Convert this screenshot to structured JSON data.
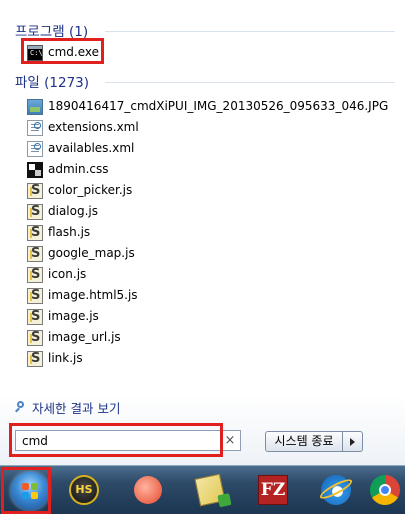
{
  "programs": {
    "header": "프로그램 (1)",
    "items": [
      {
        "label": "cmd.exe",
        "icon": "cmd-icon"
      }
    ]
  },
  "files": {
    "header": "파일 (1273)",
    "items": [
      {
        "label": "1890416417_cmdXiPUI_IMG_20130526_095633_046.JPG",
        "icon": "image-file-icon"
      },
      {
        "label": "extensions.xml",
        "icon": "xml-file-icon"
      },
      {
        "label": "availables.xml",
        "icon": "xml-file-icon"
      },
      {
        "label": "admin.css",
        "icon": "css-file-icon"
      },
      {
        "label": "color_picker.js",
        "icon": "js-file-icon"
      },
      {
        "label": "dialog.js",
        "icon": "js-file-icon"
      },
      {
        "label": "flash.js",
        "icon": "js-file-icon"
      },
      {
        "label": "google_map.js",
        "icon": "js-file-icon"
      },
      {
        "label": "icon.js",
        "icon": "js-file-icon"
      },
      {
        "label": "image.html5.js",
        "icon": "js-file-icon"
      },
      {
        "label": "image.js",
        "icon": "js-file-icon"
      },
      {
        "label": "image_url.js",
        "icon": "js-file-icon"
      },
      {
        "label": "link.js",
        "icon": "js-file-icon"
      }
    ]
  },
  "more_results": "자세한 결과 보기",
  "search": {
    "value": "cmd",
    "clear": "×"
  },
  "shutdown": {
    "label": "시스템 종료"
  },
  "taskbar": {
    "items": [
      "start-button",
      "hs-app-icon",
      "curl-app-icon",
      "notes-app-icon",
      "filezilla-icon",
      "internet-explorer-icon",
      "chrome-icon"
    ],
    "hs_text": "HS",
    "fz_text": "FZ"
  },
  "colors": {
    "highlight": "#e0201e",
    "header_text": "#1e3287"
  }
}
